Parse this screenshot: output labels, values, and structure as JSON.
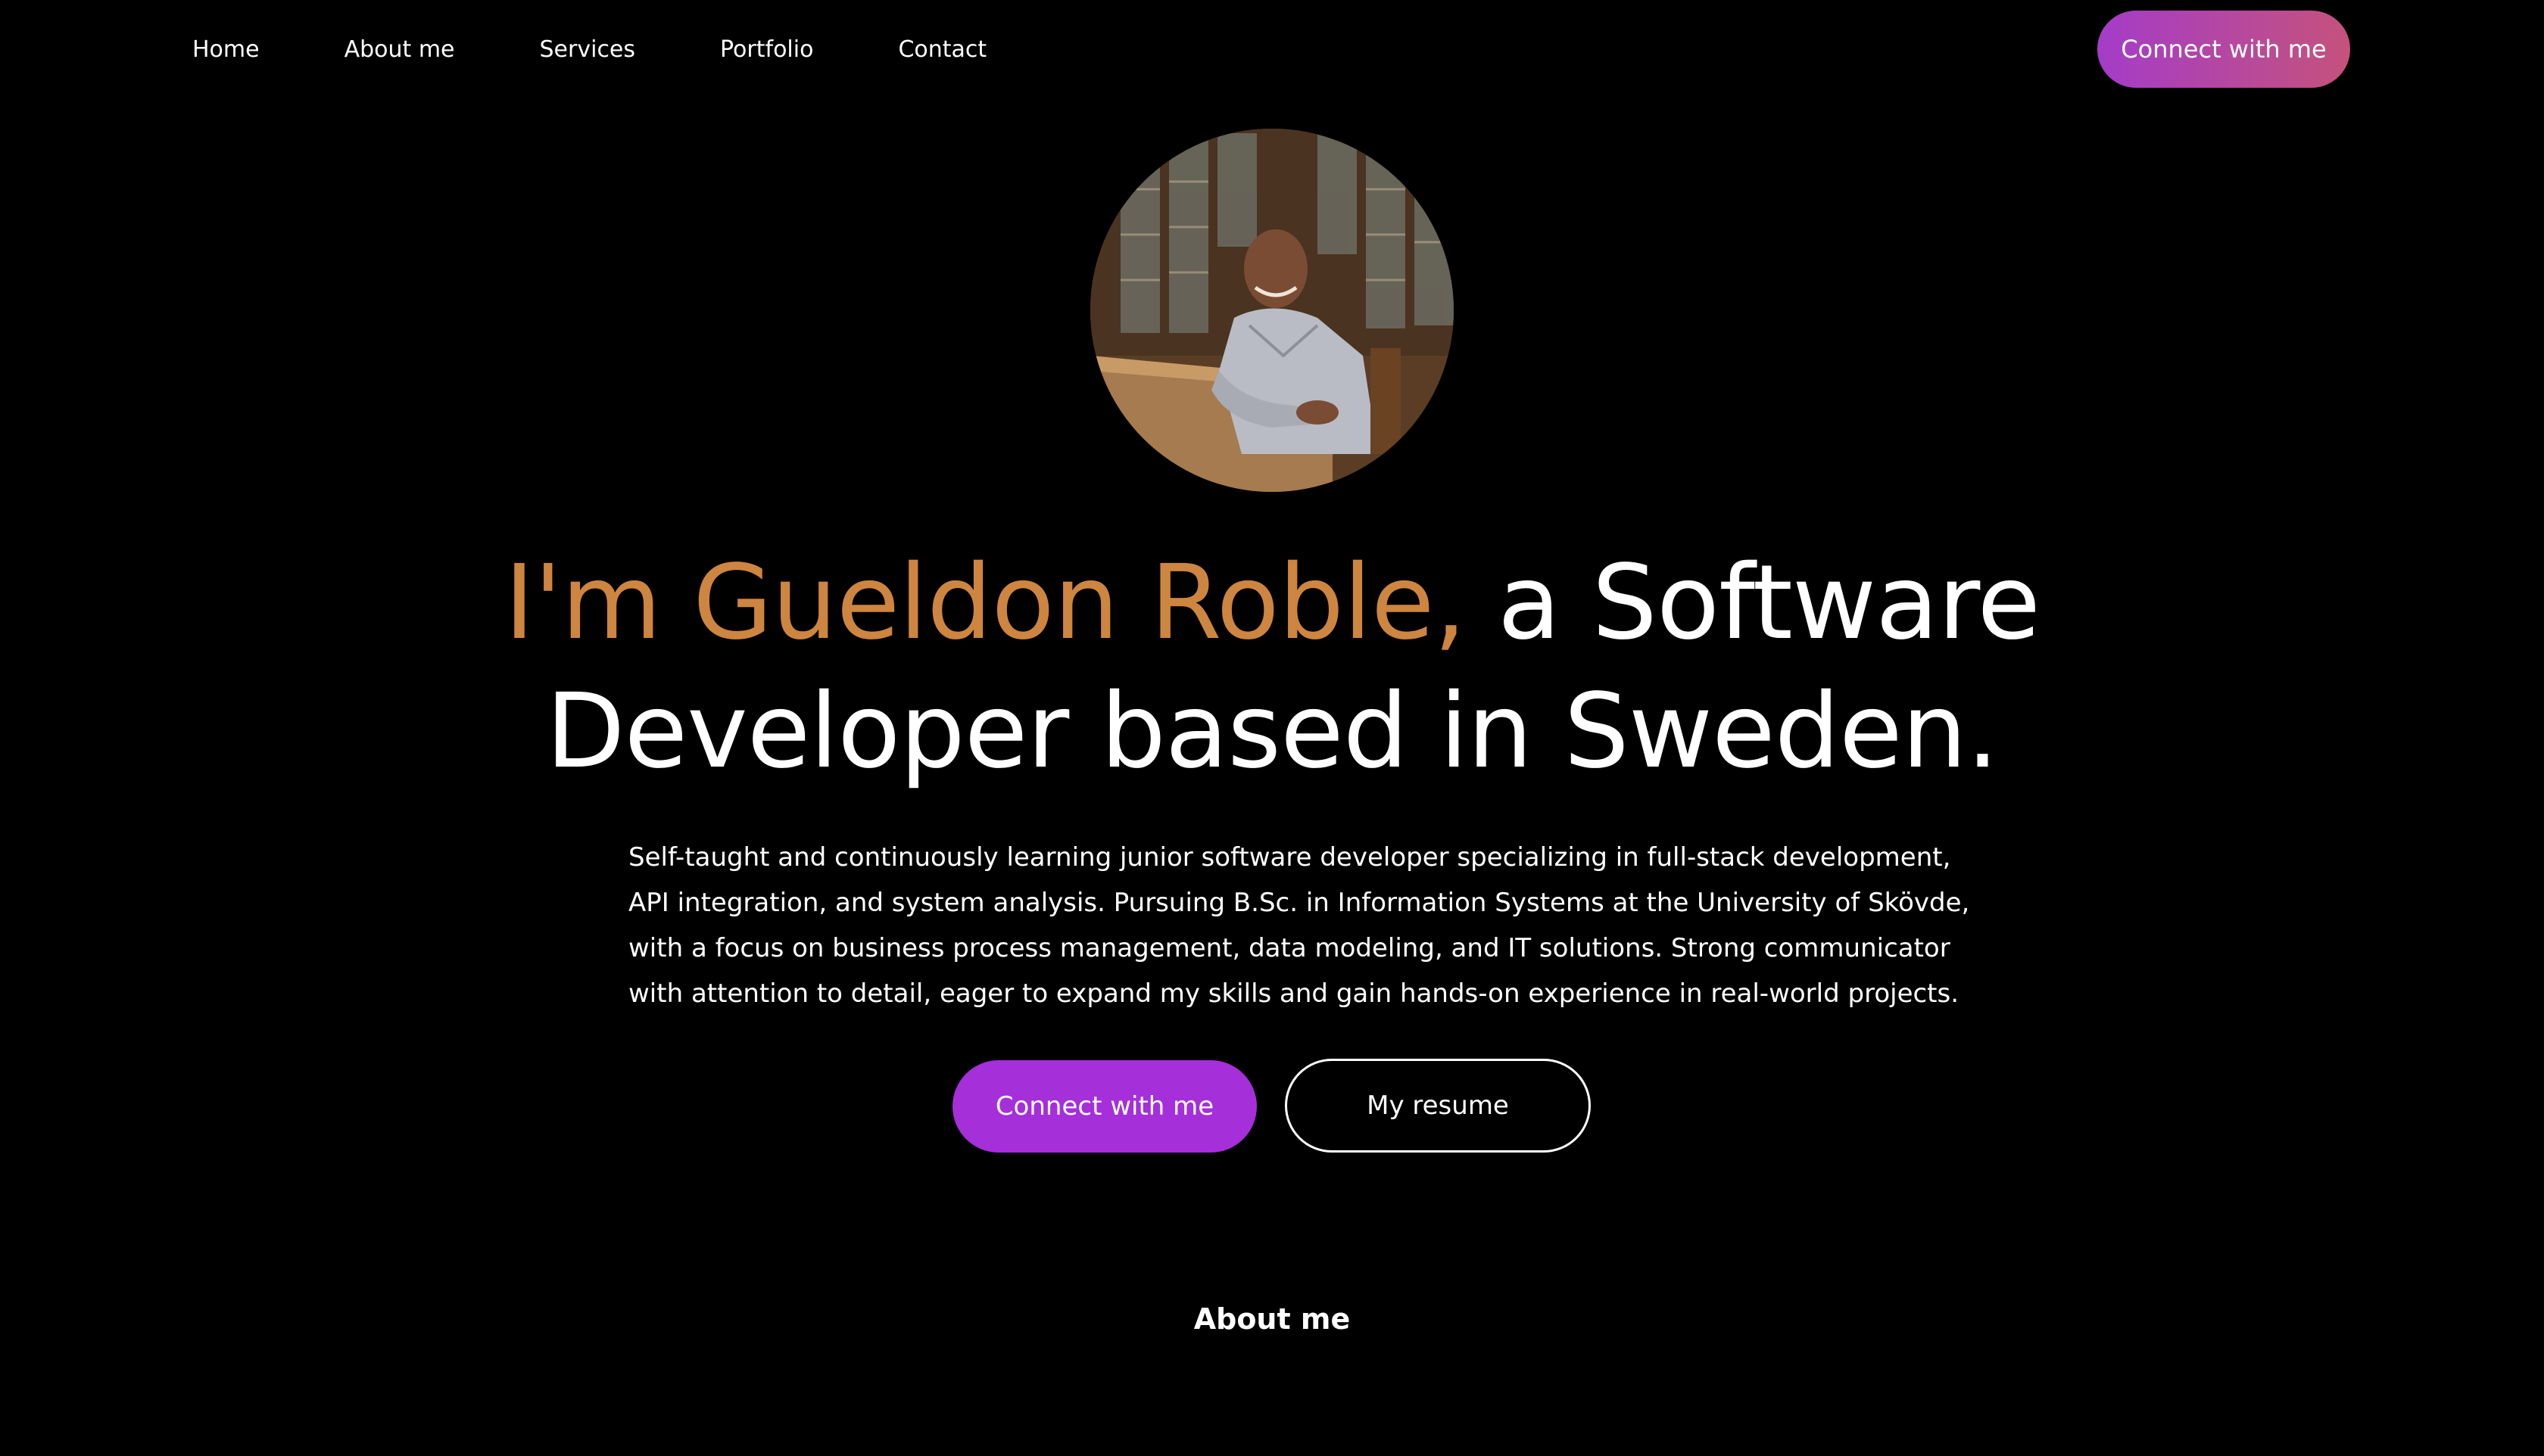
{
  "colors": {
    "background": "#000000",
    "accent": "#CD8540",
    "primary_button": "#A52FD9",
    "nav_cta_gradient_start": "#A43CC8",
    "nav_cta_gradient_end": "#C5527C"
  },
  "nav": {
    "links": [
      {
        "label": "Home"
      },
      {
        "label": "About me"
      },
      {
        "label": "Services"
      },
      {
        "label": "Portfolio"
      },
      {
        "label": "Contact"
      }
    ],
    "cta_label": "Connect with me"
  },
  "hero": {
    "avatar_icon": "profile-photo",
    "headline_accent": "I'm Gueldon Roble,",
    "headline_line1_rest": " a Software",
    "headline_line2": "Developer based in Sweden.",
    "description_lines": [
      "Self-taught and continuously learning junior software developer specializing in full-stack development,",
      "API integration, and system analysis. Pursuing B.Sc. in Information Systems at the University of Skövde,",
      "with a focus on business process management, data modeling, and IT solutions. Strong communicator",
      "with attention to detail, eager to expand my skills and gain hands-on experience in real-world projects."
    ],
    "primary_button_label": "Connect with me",
    "secondary_button_label": "My resume"
  },
  "about": {
    "title": "About me"
  }
}
